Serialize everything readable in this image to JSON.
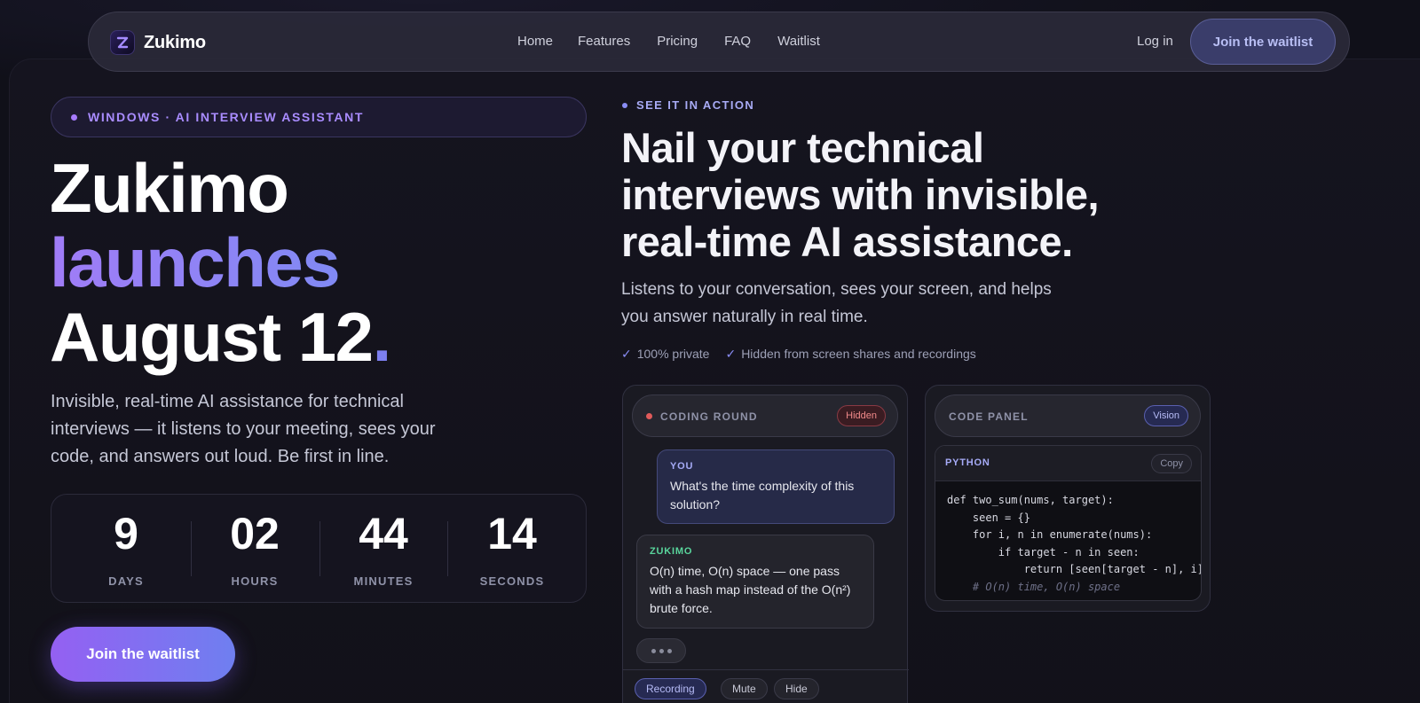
{
  "nav": {
    "brand": "Zukimo",
    "links": [
      "Home",
      "Features",
      "Pricing",
      "FAQ",
      "Waitlist"
    ],
    "login": "Log in",
    "cta": "Join the waitlist"
  },
  "hero": {
    "badge": "WINDOWS · AI INTERVIEW ASSISTANT",
    "title_line1": "Zukimo",
    "title_line2": "launches",
    "title_line3": "August 12",
    "title_period": ".",
    "description": "Invisible, real-time AI assistance for technical interviews — it listens to your meeting, sees your code, and answers out loud. Be first in line.",
    "countdown": [
      {
        "value": "9",
        "label": "DAYS"
      },
      {
        "value": "02",
        "label": "HOURS"
      },
      {
        "value": "44",
        "label": "MINUTES"
      },
      {
        "value": "14",
        "label": "SECONDS"
      }
    ],
    "cta": "Join the waitlist"
  },
  "action": {
    "eyebrow": "SEE IT IN ACTION",
    "title": "Nail your technical interviews with invisible, real-time AI assistance.",
    "description": "Listens to your conversation, sees your screen, and helps you answer naturally in real time.",
    "checks": [
      "100% private",
      "Hidden from screen shares and recordings"
    ],
    "check_mark": "✓"
  },
  "coding_card": {
    "label": "CODING ROUND",
    "tag": "Hidden",
    "you_label": "YOU",
    "you_message": "What's the time complexity of this solution?",
    "zukimo_label": "ZUKIMO",
    "zukimo_message": "O(n) time, O(n) space — one pass with a hash map instead of the O(n²) brute force.",
    "chips": [
      "Recording",
      "Mute",
      "Hide"
    ]
  },
  "code_card": {
    "label": "CODE PANEL",
    "tag": "Vision",
    "language": "PYTHON",
    "copy_label": "Copy",
    "lines": [
      "def two_sum(nums, target):",
      "    seen = {}",
      "    for i, n in enumerate(nums):",
      "        if target - n in seen:",
      "            return [seen[target - n], i]",
      "    # O(n) time, O(n) space"
    ]
  },
  "colors": {
    "accent": "#7d7ff0",
    "accent_purple": "#9460f2",
    "background": "#101019",
    "danger": "#e05a5a",
    "success": "#59d59c"
  }
}
